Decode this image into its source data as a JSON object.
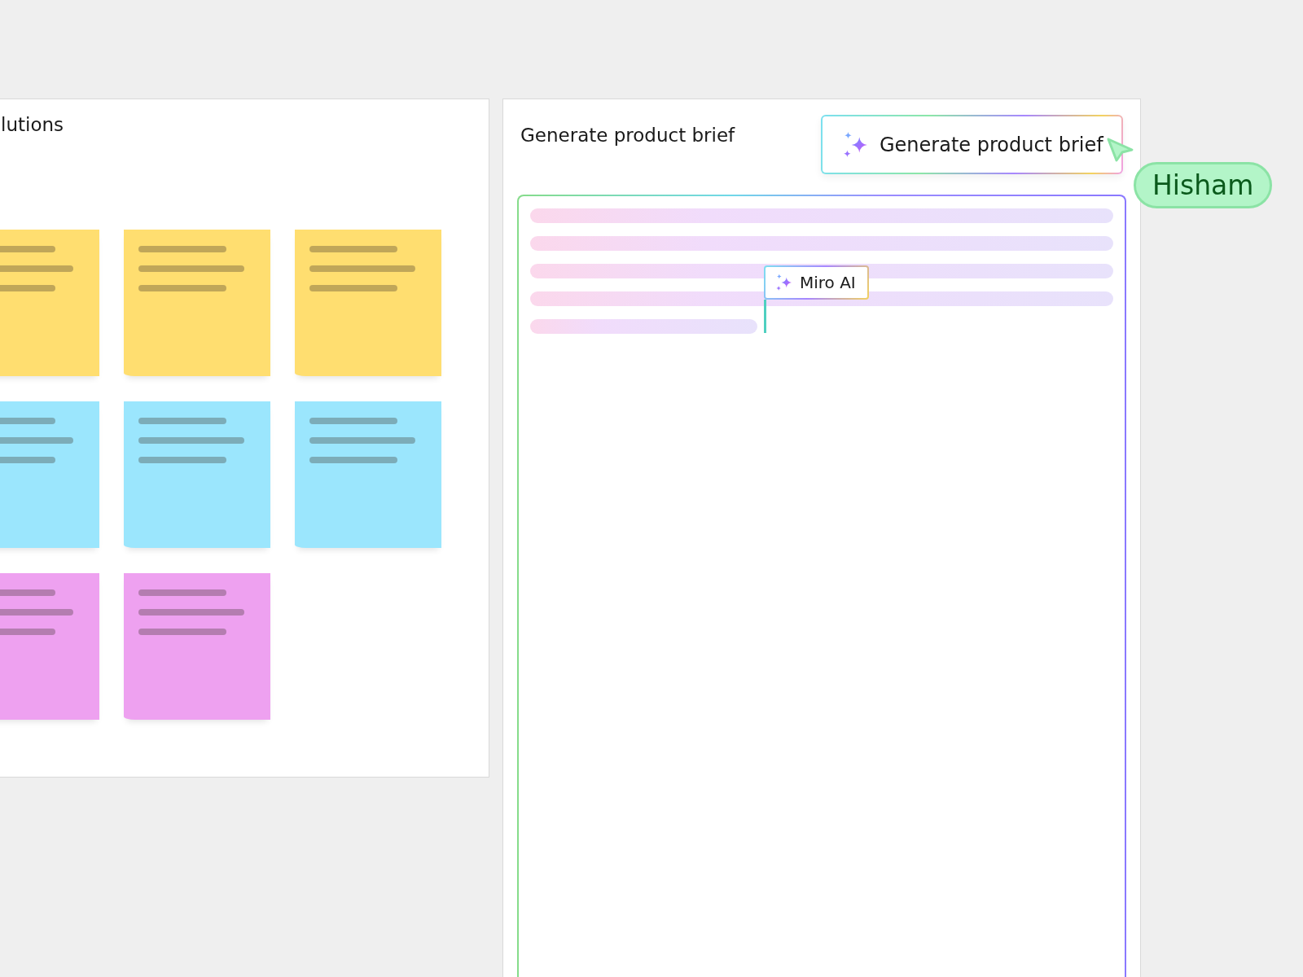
{
  "left_frame": {
    "title": "lutions",
    "stickies": [
      {
        "color": "#ffde70"
      },
      {
        "color": "#ffde70"
      },
      {
        "color": "#ffde70"
      },
      {
        "color": "#9be6fd"
      },
      {
        "color": "#9be6fd"
      },
      {
        "color": "#9be6fd"
      },
      {
        "color": "#eea1f0"
      },
      {
        "color": "#eea1f0"
      }
    ]
  },
  "right_frame": {
    "title": "Generate product brief",
    "button": {
      "label": "Generate product brief"
    },
    "document": {
      "ai_cursor": {
        "label": "Miro AI"
      }
    }
  },
  "collaborator_cursor": {
    "name": "Hisham"
  }
}
